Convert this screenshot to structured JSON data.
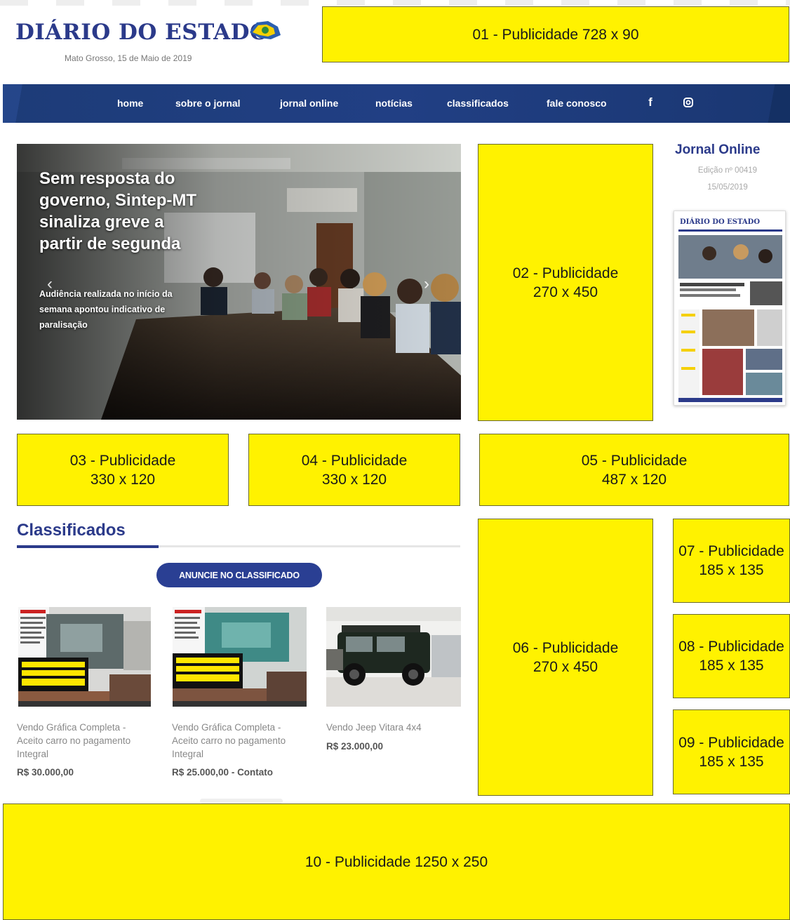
{
  "header": {
    "logo_text": "DIÁRIO DO ESTADO",
    "dateline": "Mato Grosso, 15 de Maio de 2019"
  },
  "nav": {
    "items": [
      "home",
      "sobre o jornal",
      "jornal online",
      "notícias",
      "classificados",
      "fale conosco"
    ],
    "icons": [
      "facebook-icon",
      "instagram-icon"
    ]
  },
  "hero": {
    "title": "Sem resposta do governo, Sintep-MT sinaliza greve a partir de segunda",
    "subtitle": "Audiência realizada no início da semana apontou indicativo de paralisação"
  },
  "jornal_online": {
    "title": "Jornal Online",
    "edition": "Edição nº 00419",
    "date": "15/05/2019",
    "paper_masthead": "DIÁRIO DO ESTADO"
  },
  "ads": {
    "a01": "01 - Publicidade 728 x 90",
    "a02": "02 - Publicidade\n270 x 450",
    "a03": "03 - Publicidade\n330 x 120",
    "a04": "04 - Publicidade\n330 x 120",
    "a05": "05 - Publicidade\n487 x 120",
    "a06": "06 - Publicidade\n270 x 450",
    "a07": "07 - Publicidade\n185 x 135",
    "a08": "08 - Publicidade\n185 x 135",
    "a09": "09 - Publicidade\n185 x 135",
    "a10": "10 - Publicidade 1250 x 250"
  },
  "classificados": {
    "title": "Classificados",
    "button": "ANUNCIE NO CLASSIFICADO",
    "items": [
      {
        "name": "Vendo Gráfica Completa - Aceito carro no pagamento Integral",
        "price": "R$ 30.000,00"
      },
      {
        "name": "Vendo Gráfica Completa - Aceito carro no pagamento Integral",
        "price": "R$ 25.000,00 - Contato"
      },
      {
        "name": "Vendo Jeep Vitara 4x4",
        "price": "R$ 23.000,00"
      }
    ]
  },
  "colors": {
    "brand_blue": "#2b3a8a",
    "nav_blue": "#1d3c78",
    "ad_yellow": "#fff200"
  }
}
